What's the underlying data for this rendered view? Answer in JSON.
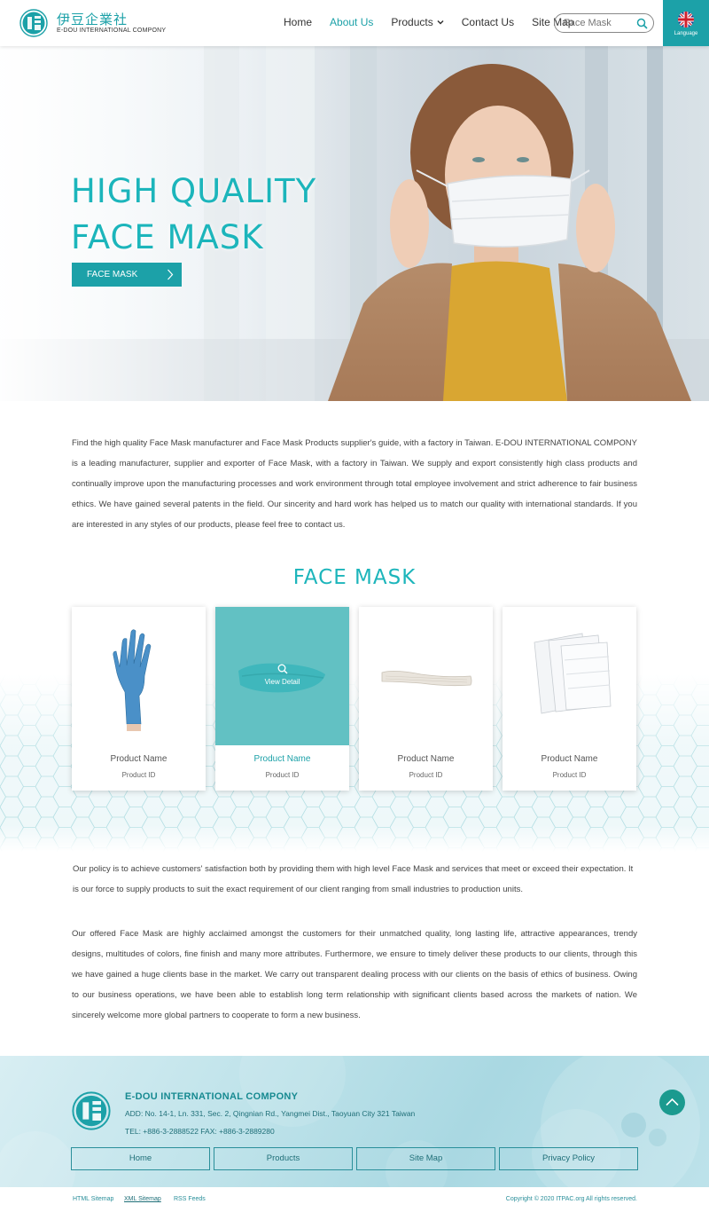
{
  "header": {
    "brand_cn": "伊豆企業社",
    "brand_en": "E-DOU INTERNATIONAL COMPONY",
    "nav": [
      {
        "label": "Home"
      },
      {
        "label": "About Us"
      },
      {
        "label": "Products"
      },
      {
        "label": "Contact Us"
      },
      {
        "label": "Site Map"
      }
    ],
    "search_placeholder": "Face Mask",
    "language_label": "Language",
    "accent_color": "#1ca1a8"
  },
  "hero": {
    "title_line1": "HIGH QUALITY",
    "title_line2": "FACE MASK",
    "button_label": "FACE MASK"
  },
  "intro_text": "Find the high quality Face Mask manufacturer and Face Mask Products supplier's guide, with a factory in Taiwan. E-DOU INTERNATIONAL COMPONY is a leading manufacturer, supplier and exporter of Face Mask, with a factory in Taiwan. We supply and export consistently high class products and continually improve upon the manufacturing processes and work environment through total employee involvement and strict adherence to fair business ethics. We have gained several patents in the field. Our sincerity and hard work has helped us to match our quality with international standards. If you are interested in any styles of our products, please feel free to contact us.",
  "products_section": {
    "title": "FACE MASK",
    "view_detail": "View  Detail",
    "items": [
      {
        "name": "Product Name",
        "id": "Product ID",
        "image": "blue-glove"
      },
      {
        "name": "Product Name",
        "id": "Product ID",
        "image": "shoe-cover"
      },
      {
        "name": "Product Name",
        "id": "Product ID",
        "image": "hair-net"
      },
      {
        "name": "Product Name",
        "id": "Product ID",
        "image": "face-mask-pack"
      }
    ]
  },
  "policy_text": "Our policy is to achieve customers' satisfaction both by providing them with high level Face Mask and services that meet or exceed their expectation. It is our force to supply products to suit the exact requirement of our client ranging from small industries to production units.",
  "offered_text": "Our offered Face Mask are highly acclaimed amongst the customers for their unmatched quality, long lasting life, attractive appearances, trendy designs, multitudes of colors, fine finish and many more attributes. Furthermore, we ensure to timely deliver these products to our clients, through this we have gained a huge clients base in the market. We carry out transparent dealing process with our clients on the basis of ethics of business. Owing to our business operations, we have been able to establish long term relationship with significant clients based across the markets of nation. We sincerely welcome more global partners to cooperate to form a new business.",
  "footer": {
    "company": "E-DOU INTERNATIONAL COMPONY",
    "address": "ADD: No. 14-1, Ln. 331, Sec. 2, Qingnian Rd., Yangmei Dist., Taoyuan City 321 Taiwan",
    "tel": "TEL: +886-3-2888522    FAX: +886-3-2889280",
    "links": [
      {
        "label": "Home"
      },
      {
        "label": "Products"
      },
      {
        "label": "Site Map"
      },
      {
        "label": "Privacy Policy"
      }
    ]
  },
  "bottom_bar": {
    "html_sitemap": "HTML Sitemap",
    "xml_sitemap": "XML Sitemap",
    "rss": "RSS Feeds",
    "copyright": "Copyright © 2020 ITPAC.org All rights reserved."
  }
}
